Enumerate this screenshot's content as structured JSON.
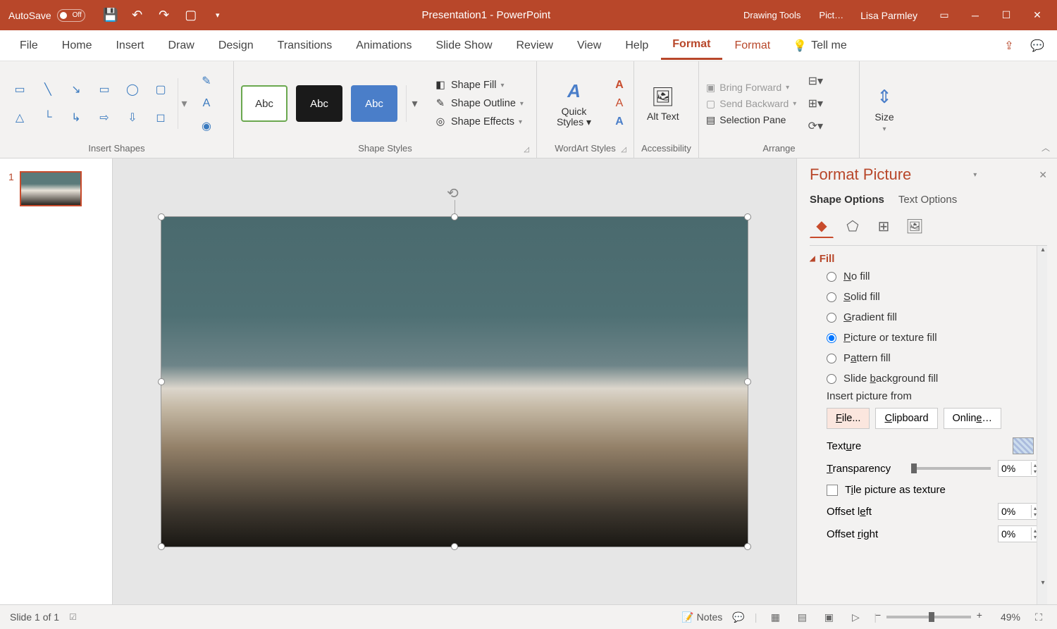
{
  "titlebar": {
    "autosave_label": "AutoSave",
    "autosave_state": "Off",
    "doc_title": "Presentation1  -  PowerPoint",
    "context_tabs": [
      "Drawing Tools",
      "Pict…"
    ],
    "user": "Lisa Parmley"
  },
  "tabs": {
    "items": [
      "File",
      "Home",
      "Insert",
      "Draw",
      "Design",
      "Transitions",
      "Animations",
      "Slide Show",
      "Review",
      "View",
      "Help",
      "Format",
      "Format"
    ],
    "active_index": 11,
    "tellme": "Tell me"
  },
  "ribbon": {
    "groups": {
      "insert_shapes": "Insert Shapes",
      "shape_styles": "Shape Styles",
      "wordart_styles": "WordArt Styles",
      "accessibility": "Accessibility",
      "arrange": "Arrange",
      "size": "Size"
    },
    "style_labels": [
      "Abc",
      "Abc",
      "Abc"
    ],
    "shape_fill": "Shape Fill",
    "shape_outline": "Shape Outline",
    "shape_effects": "Shape Effects",
    "quick_styles": "Quick Styles",
    "alt_text": "Alt Text",
    "bring_forward": "Bring Forward",
    "send_backward": "Send Backward",
    "selection_pane": "Selection Pane",
    "size_btn": "Size"
  },
  "thumbnails": {
    "slide_num": "1"
  },
  "format_pane": {
    "title": "Format Picture",
    "tabs": [
      "Shape Options",
      "Text Options"
    ],
    "section": "Fill",
    "options": [
      "No fill",
      "Solid fill",
      "Gradient fill",
      "Picture or texture fill",
      "Pattern fill",
      "Slide background fill"
    ],
    "selected_option": 3,
    "insert_from": "Insert picture from",
    "buttons": [
      "File...",
      "Clipboard",
      "Online…"
    ],
    "texture": "Texture",
    "transparency": "Transparency",
    "transparency_val": "0%",
    "tile": "Tile picture as texture",
    "offset_left": "Offset left",
    "offset_left_val": "0%",
    "offset_right": "Offset right",
    "offset_right_val": "0%"
  },
  "statusbar": {
    "slide_info": "Slide 1 of 1",
    "notes": "Notes",
    "zoom": "49%"
  }
}
